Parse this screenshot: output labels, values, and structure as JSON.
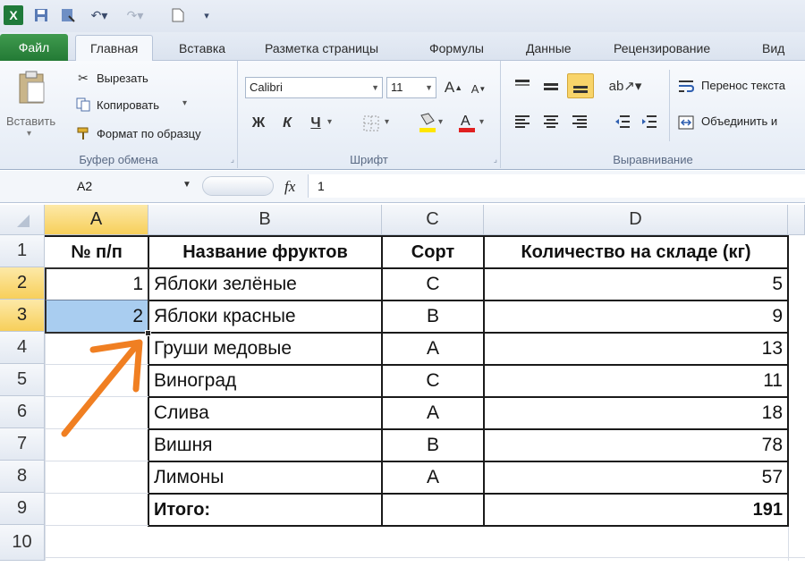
{
  "qat": {
    "icons": [
      "excel-logo-icon",
      "save-icon",
      "save-as-icon",
      "undo-icon",
      "redo-icon",
      "new-document-icon",
      "customize-icon"
    ]
  },
  "tabs": {
    "file": "Файл",
    "items": [
      "Главная",
      "Вставка",
      "Разметка страницы",
      "Формулы",
      "Данные",
      "Рецензирование",
      "Вид"
    ]
  },
  "ribbon": {
    "clipboard": {
      "paste": "Вставить",
      "cut": "Вырезать",
      "copy": "Копировать",
      "format_painter": "Формат по образцу",
      "label": "Буфер обмена"
    },
    "font": {
      "font_name": "Calibri",
      "font_size": "11",
      "bold": "Ж",
      "italic": "К",
      "underline": "Ч",
      "label": "Шрифт"
    },
    "alignment": {
      "wrap_text": "Перенос текста",
      "merge": "Объединить и",
      "label": "Выравнивание"
    }
  },
  "formula_bar": {
    "name_box": "A2",
    "fx": "fx",
    "value": "1"
  },
  "sheet": {
    "columns": [
      "A",
      "B",
      "C",
      "D"
    ],
    "row_numbers": [
      "1",
      "2",
      "3",
      "4",
      "5",
      "6",
      "7",
      "8",
      "9",
      "10"
    ],
    "headers": {
      "a": "№ п/п",
      "b": "Название фруктов",
      "c": "Сорт",
      "d": "Количество на складе (кг)"
    },
    "rows": [
      {
        "a": "1",
        "b": "Яблоки зелёные",
        "c": "С",
        "d": "5"
      },
      {
        "a": "2",
        "b": "Яблоки красные",
        "c": "В",
        "d": "9"
      },
      {
        "a": "",
        "b": "Груши медовые",
        "c": "А",
        "d": "13"
      },
      {
        "a": "",
        "b": "Виноград",
        "c": "С",
        "d": "11"
      },
      {
        "a": "",
        "b": "Слива",
        "c": "А",
        "d": "18"
      },
      {
        "a": "",
        "b": "Вишня",
        "c": "В",
        "d": "78"
      },
      {
        "a": "",
        "b": "Лимоны",
        "c": "А",
        "d": "57"
      }
    ],
    "total": {
      "label": "Итого:",
      "value": "191"
    },
    "selected_range": "A2:A3",
    "selection_color": "#a9cdf0",
    "arrow_color": "#f07f22"
  }
}
